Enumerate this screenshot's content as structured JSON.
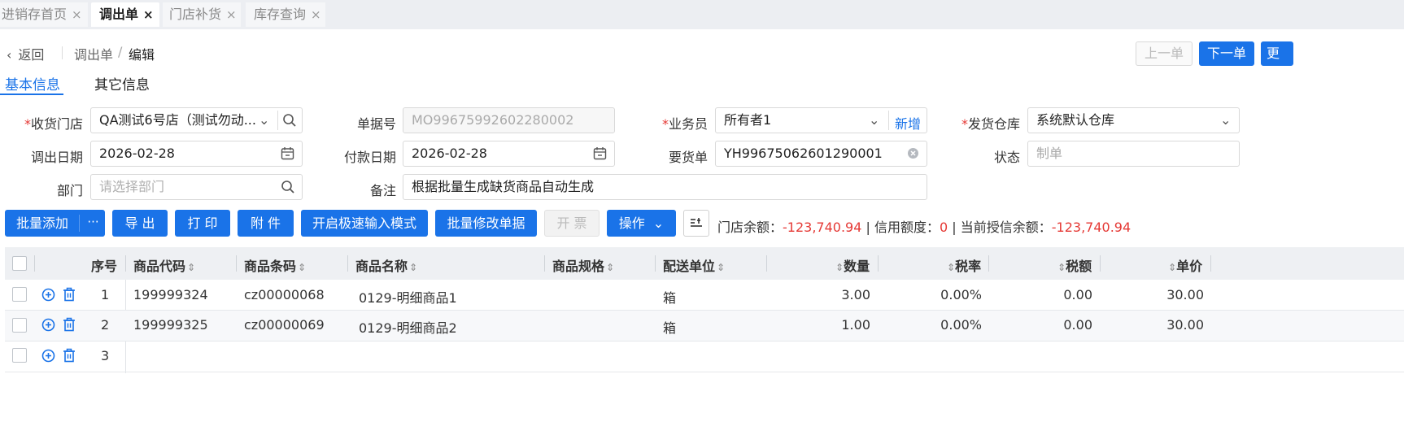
{
  "page_tabs": [
    {
      "label": "进销存首页",
      "close": "×"
    },
    {
      "label": "调出单",
      "close": "×"
    },
    {
      "label": "门店补货",
      "close": "×"
    },
    {
      "label": "库存查询",
      "close": "×"
    }
  ],
  "header": {
    "back_label": "返回",
    "crumb_parent": "调出单",
    "crumb_sep": "/",
    "crumb_current": "编辑",
    "prev_label": "上一单",
    "next_label": "下一单",
    "more_label": "更"
  },
  "sub_tabs": [
    "基本信息",
    "其它信息"
  ],
  "form": {
    "receive_store_label": "收货门店",
    "receive_store_value": "QA测试6号店（测试勿动...",
    "doc_no_label": "单据号",
    "doc_no_value": "MO99675992602280002",
    "salesman_label": "业务员",
    "salesman_value": "所有者1",
    "salesman_add": "新增",
    "warehouse_label": "发货仓库",
    "warehouse_value": "系统默认仓库",
    "out_date_label": "调出日期",
    "out_date_value": "2026-02-28",
    "pay_date_label": "付款日期",
    "pay_date_value": "2026-02-28",
    "request_label": "要货单",
    "request_value": "YH99675062601290001",
    "status_label": "状态",
    "status_value": "制单",
    "dept_label": "部门",
    "dept_placeholder": "请选择部门",
    "remark_label": "备注",
    "remark_value": "根据批量生成缺货商品自动生成"
  },
  "toolbar": {
    "batch_add": "批量添加",
    "more": "···",
    "export": "导 出",
    "print": "打 印",
    "attach": "附 件",
    "fast_input": "开启极速输入模式",
    "batch_edit": "批量修改单据",
    "invoice": "开 票",
    "operate": "操作",
    "store_balance_label": "门店余额：",
    "store_balance_value": "-123,740.94",
    "credit_label": "| 信用额度：",
    "credit_value": "0",
    "credit_balance_label": "| 当前授信余额：",
    "credit_balance_value": "-123,740.94"
  },
  "table": {
    "headers": {
      "seq": "序号",
      "code": "商品代码",
      "barcode": "商品条码",
      "name": "商品名称",
      "spec": "商品规格",
      "unit": "配送单位",
      "qty": "数量",
      "tax_rate": "税率",
      "tax": "税额",
      "price": "单价"
    },
    "rows": [
      {
        "seq": "1",
        "code": "199999324",
        "barcode": "cz00000068",
        "name": "0129-明细商品1",
        "unit": "箱",
        "qty": "3.00",
        "tax_rate": "0.00%",
        "tax": "0.00",
        "price": "30.00"
      },
      {
        "seq": "2",
        "code": "199999325",
        "barcode": "cz00000069",
        "name": "0129-明细商品2",
        "unit": "箱",
        "qty": "1.00",
        "tax_rate": "0.00%",
        "tax": "0.00",
        "price": "30.00"
      },
      {
        "seq": "3"
      }
    ]
  },
  "colors": {
    "primary": "#1a73e8",
    "danger": "#e53935"
  },
  "icons": [
    "close-icon",
    "chevron-left-icon",
    "chevron-down-icon",
    "search-icon",
    "calendar-icon",
    "clear-icon",
    "add-circle-icon",
    "trash-icon",
    "sort-icon",
    "column-settings-icon"
  ]
}
